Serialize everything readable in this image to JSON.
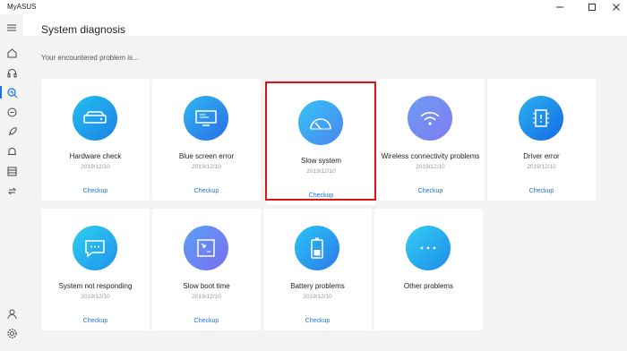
{
  "window": {
    "title": "MyASUS",
    "minimize_icon": "minimize-icon",
    "maximize_icon": "maximize-icon",
    "close_icon": "close-icon"
  },
  "sidebar": {
    "items": [
      {
        "icon": "menu-icon"
      },
      {
        "icon": "home-icon"
      },
      {
        "icon": "headset-icon"
      },
      {
        "icon": "diagnosis-icon",
        "active": true
      },
      {
        "icon": "link-icon"
      },
      {
        "icon": "rocket-icon"
      },
      {
        "icon": "bell-icon"
      },
      {
        "icon": "store-icon"
      },
      {
        "icon": "transfer-icon"
      },
      {
        "icon": "user-icon"
      },
      {
        "icon": "settings-icon"
      }
    ]
  },
  "page": {
    "title": "System diagnosis",
    "subtitle": "Your encountered problem is...",
    "accent_color": "#1e73d8",
    "highlight_color": "#e01414"
  },
  "cards": [
    {
      "label": "Hardware check",
      "date": "2019/12/10",
      "action": "Checkup",
      "icon": "hard-drive-icon"
    },
    {
      "label": "Blue screen error",
      "date": "2019/12/10",
      "action": "Checkup",
      "icon": "monitor-icon"
    },
    {
      "label": "Slow system",
      "date": "2019/12/10",
      "action": "Checkup",
      "icon": "speedometer-icon"
    },
    {
      "label": "Wireless connectivity problems",
      "date": "2019/12/10",
      "action": "Checkup",
      "icon": "wifi-icon"
    },
    {
      "label": "Driver error",
      "date": "2019/12/10",
      "action": "Checkup",
      "icon": "chip-icon"
    },
    {
      "label": "System not responding",
      "date": "2019/12/10",
      "action": "Checkup",
      "icon": "chat-bubble-icon"
    },
    {
      "label": "Slow boot time",
      "date": "2019/12/10",
      "action": "Checkup",
      "icon": "boot-screen-icon"
    },
    {
      "label": "Battery problems",
      "date": "2019/12/10",
      "action": "Checkup",
      "icon": "battery-icon"
    },
    {
      "label": "Other problems",
      "date": "",
      "action": "",
      "icon": "ellipsis-icon"
    }
  ]
}
